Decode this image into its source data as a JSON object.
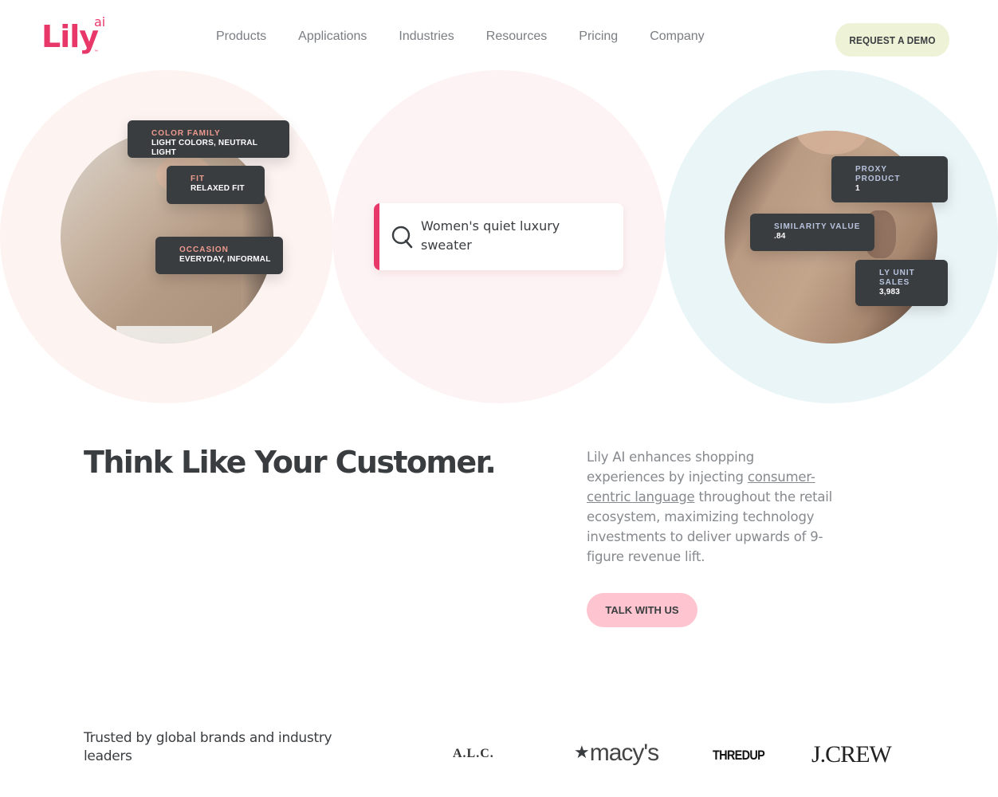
{
  "header": {
    "logo": {
      "main": "Lily",
      "superscript": "ai",
      "tm": "™"
    },
    "nav": [
      {
        "label": "Products"
      },
      {
        "label": "Applications"
      },
      {
        "label": "Industries"
      },
      {
        "label": "Resources"
      },
      {
        "label": "Pricing"
      },
      {
        "label": "Company"
      }
    ],
    "cta_label": "REQUEST A DEMO"
  },
  "hero": {
    "left_tags": [
      {
        "key": "COLOR FAMILY",
        "value": "LIGHT COLORS, NEUTRAL LIGHT"
      },
      {
        "key": "FIT",
        "value": "RELAXED FIT"
      },
      {
        "key": "OCCASION",
        "value": "EVERYDAY, INFORMAL"
      }
    ],
    "search_query": "Women's quiet luxury sweater",
    "right_tags": [
      {
        "key": "PROXY PRODUCT",
        "value": "1"
      },
      {
        "key": "SIMILARITY VALUE",
        "value": ".84"
      },
      {
        "key": "LY UNIT SALES",
        "value": "3,983"
      }
    ],
    "colors": {
      "circle_left": "#fdf4f2",
      "circle_center": "#fdf3f5",
      "circle_right": "#eaf5f8",
      "accent": "#e8386a"
    }
  },
  "intro": {
    "headline": "Think Like Your Customer.",
    "paragraph_before": "Lily AI enhances shopping experiences by injecting ",
    "paragraph_link": "consumer-centric language",
    "paragraph_after": " throughout the retail ecosystem, maximizing technology investments to deliver upwards of 9-figure revenue lift.",
    "cta_label": "TALK WITH US"
  },
  "trusted": {
    "label": "Trusted by global brands and industry leaders",
    "brands": [
      {
        "name": "A.L.C."
      },
      {
        "name": "macy's",
        "icon": "star-icon"
      },
      {
        "name": "THREDUP"
      },
      {
        "name": "J.CREW"
      }
    ]
  }
}
